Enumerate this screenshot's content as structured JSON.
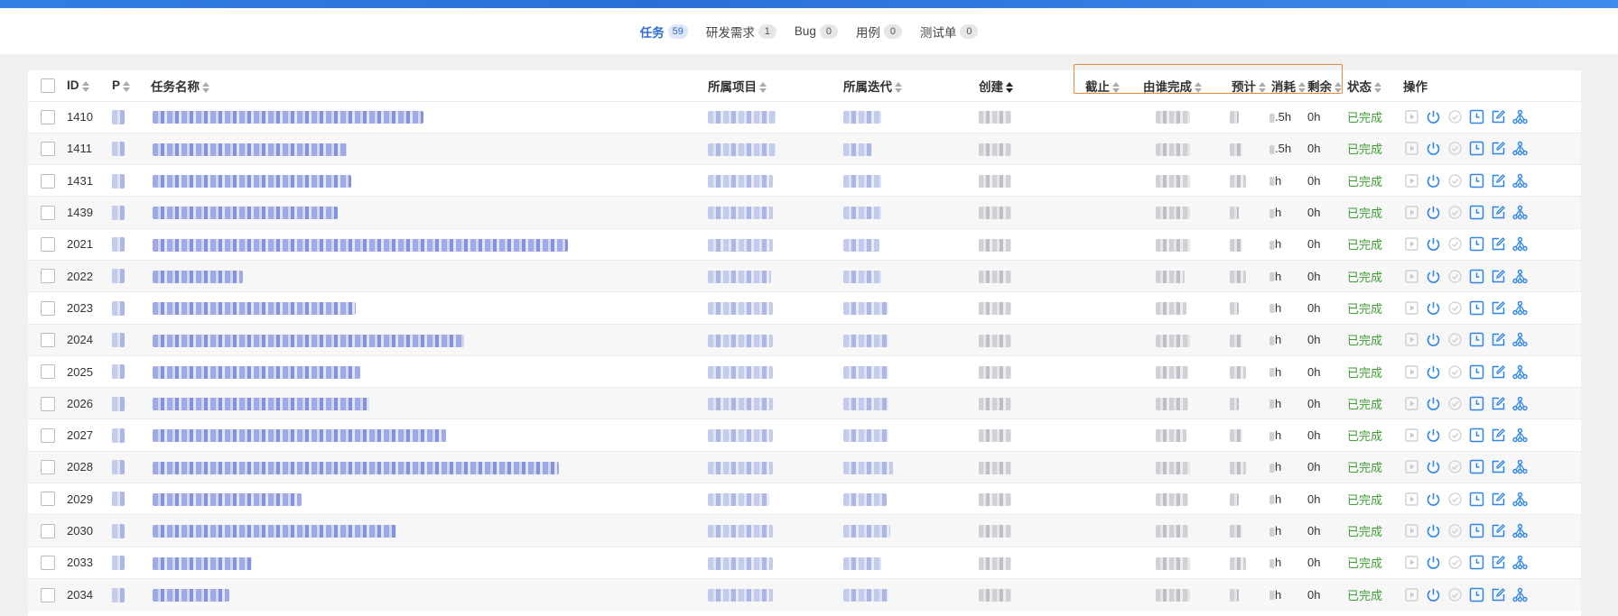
{
  "tabs": [
    {
      "label": "任务",
      "count": "59",
      "active": true
    },
    {
      "label": "研发需求",
      "count": "1",
      "active": false
    },
    {
      "label": "Bug",
      "count": "0",
      "active": false
    },
    {
      "label": "用例",
      "count": "0",
      "active": false
    },
    {
      "label": "测试单",
      "count": "0",
      "active": false
    }
  ],
  "columns": {
    "id": "ID",
    "pri": "P",
    "name": "任务名称",
    "project": "所属项目",
    "iteration": "所属迭代",
    "created": "创建",
    "deadline": "截止",
    "finished_by": "由谁完成",
    "estimate": "预计",
    "consumed": "消耗",
    "left": "剩余",
    "status": "状态",
    "actions": "操作"
  },
  "rows": [
    {
      "id": "1410",
      "consumed": ".5h",
      "left": "0h",
      "status": "已完成"
    },
    {
      "id": "1411",
      "consumed": ".5h",
      "left": "0h",
      "status": "已完成"
    },
    {
      "id": "1431",
      "consumed": "h",
      "left": "0h",
      "status": "已完成"
    },
    {
      "id": "1439",
      "consumed": "h",
      "left": "0h",
      "status": "已完成"
    },
    {
      "id": "2021",
      "consumed": "h",
      "left": "0h",
      "status": "已完成"
    },
    {
      "id": "2022",
      "consumed": "h",
      "left": "0h",
      "status": "已完成"
    },
    {
      "id": "2023",
      "consumed": "h",
      "left": "0h",
      "status": "已完成"
    },
    {
      "id": "2024",
      "consumed": "h",
      "left": "0h",
      "status": "已完成"
    },
    {
      "id": "2025",
      "consumed": "h",
      "left": "0h",
      "status": "已完成"
    },
    {
      "id": "2026",
      "consumed": "h",
      "left": "0h",
      "status": "已完成"
    },
    {
      "id": "2027",
      "consumed": "h",
      "left": "0h",
      "status": "已完成"
    },
    {
      "id": "2028",
      "consumed": "h",
      "left": "0h",
      "status": "已完成"
    },
    {
      "id": "2029",
      "consumed": "h",
      "left": "0h",
      "status": "已完成"
    },
    {
      "id": "2030",
      "consumed": "h",
      "left": "0h",
      "status": "已完成"
    },
    {
      "id": "2033",
      "consumed": "h",
      "left": "0h",
      "status": "已完成"
    },
    {
      "id": "2034",
      "consumed": "h",
      "left": "0h",
      "status": "已完成"
    }
  ],
  "colors": {
    "accent": "#2f6fd6",
    "status_done": "#3f9d33",
    "highlight_box": "#e8893b",
    "action_icon": "#2f86e6"
  },
  "action_icons": [
    "start-icon",
    "close-icon",
    "finish-icon",
    "record-effort-icon",
    "edit-icon",
    "split-task-icon"
  ]
}
